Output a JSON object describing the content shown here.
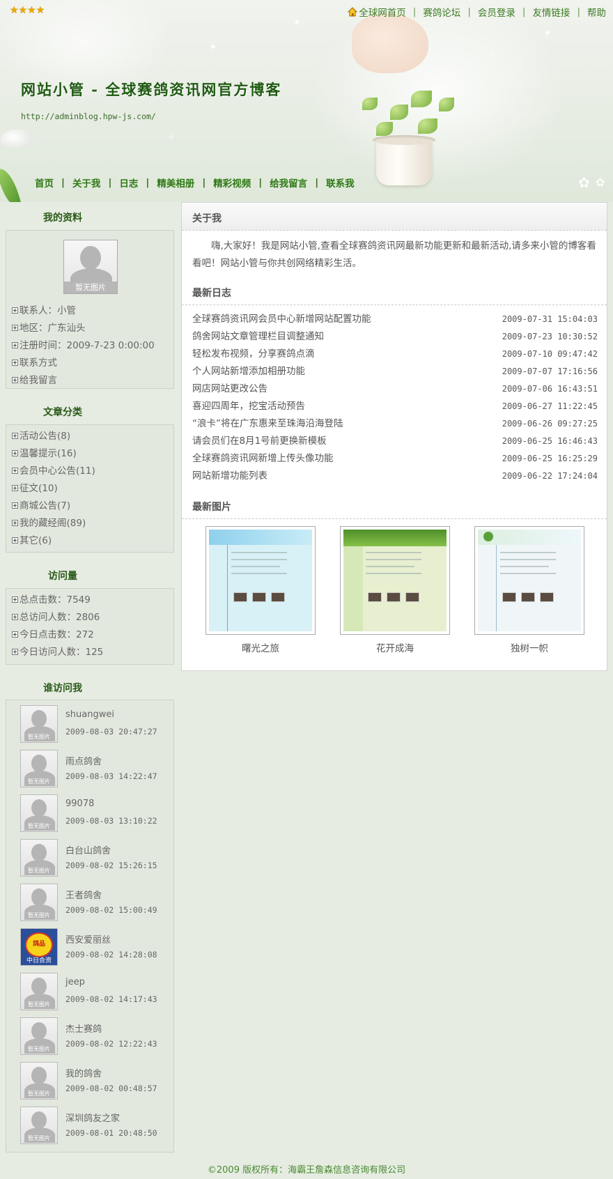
{
  "header": {
    "rating_stars": "★★★★",
    "site_title": "网站小管 - 全球赛鸽资讯网官方博客",
    "site_url": "http://adminblog.hpw-js.com/",
    "top_links": [
      "全球网首页",
      "赛鸽论坛",
      "会员登录",
      "友情链接",
      "帮助"
    ],
    "nav": [
      "首页",
      "关于我",
      "日志",
      "精美相册",
      "精彩视频",
      "给我留言",
      "联系我"
    ]
  },
  "profile": {
    "title": "我的资料",
    "avatar_caption": "暂无图片",
    "items": [
      "联系人：小管",
      "地区：广东汕头",
      "注册时间：2009-7-23 0:00:00",
      "联系方式",
      "给我留言"
    ]
  },
  "categories": {
    "title": "文章分类",
    "items": [
      "活动公告(8)",
      "温馨提示(16)",
      "会员中心公告(11)",
      "征文(10)",
      "商城公告(7)",
      "我的藏经阁(89)",
      "其它(6)"
    ]
  },
  "stats": {
    "title": "访问量",
    "items": [
      "总点击数：7549",
      "总访问人数：2806",
      "今日点击数：272",
      "今日访问人数：125"
    ]
  },
  "visitors": {
    "title": "谁访问我",
    "avatar_caption": "暂无图片",
    "special_avatar": {
      "badge": "鸽品",
      "caption": "中日合资"
    },
    "items": [
      {
        "name": "shuangwei",
        "time": "2009-08-03 20:47:27"
      },
      {
        "name": "雨点鸽舍",
        "time": "2009-08-03 14:22:47"
      },
      {
        "name": "99078",
        "time": "2009-08-03 13:10:22"
      },
      {
        "name": "白台山鸽舍",
        "time": "2009-08-02 15:26:15"
      },
      {
        "name": "王者鸽舍",
        "time": "2009-08-02 15:00:49"
      },
      {
        "name": "西安爱丽丝",
        "time": "2009-08-02 14:28:08"
      },
      {
        "name": "jeep",
        "time": "2009-08-02 14:17:43"
      },
      {
        "name": "杰士赛鸽",
        "time": "2009-08-02 12:22:43"
      },
      {
        "name": "我的鸽舍",
        "time": "2009-08-02 00:48:57"
      },
      {
        "name": "深圳鸽友之家",
        "time": "2009-08-01 20:48:50"
      }
    ]
  },
  "about": {
    "title": "关于我",
    "text": "嗨,大家好！我是网站小管,查看全球赛鸽资讯网最新功能更新和最新活动,请多来小管的博客看看吧！网站小管与你共创网络精彩生活。"
  },
  "latest_posts": {
    "title": "最新日志",
    "items": [
      {
        "title": "全球赛鸽资讯网会员中心新增网站配置功能",
        "date": "2009-07-31 15:04:03"
      },
      {
        "title": "鸽舍网站文章管理栏目调整通知",
        "date": "2009-07-23 10:30:52"
      },
      {
        "title": "轻松发布视频，分享赛鸽点滴",
        "date": "2009-07-10 09:47:42"
      },
      {
        "title": "个人网站新增添加相册功能",
        "date": "2009-07-07 17:16:56"
      },
      {
        "title": "网店网站更改公告",
        "date": "2009-07-06 16:43:51"
      },
      {
        "title": "喜迎四周年，挖宝活动预告",
        "date": "2009-06-27 11:22:45"
      },
      {
        "title": "“浪卡”将在广东惠来至珠海沿海登陆",
        "date": "2009-06-26 09:27:25"
      },
      {
        "title": "请会员们在8月1号前更换新模板",
        "date": "2009-06-25 16:46:43"
      },
      {
        "title": "全球赛鸽资讯网新增上传头像功能",
        "date": "2009-06-25 16:25:29"
      },
      {
        "title": "网站新增功能列表",
        "date": "2009-06-22 17:24:04"
      }
    ]
  },
  "latest_photos": {
    "title": "最新图片",
    "items": [
      {
        "caption": "曙光之旅",
        "theme": "#d8eef6"
      },
      {
        "caption": "花开成海",
        "theme": "#d9e8c0"
      },
      {
        "caption": "独树一帜",
        "theme": "#e8f2f6"
      }
    ]
  },
  "footer": {
    "text": "©2009 版权所有：海霸王詹森信息咨询有限公司"
  },
  "colors": {
    "accent_green": "#2e7a14",
    "link_green": "#3b7a23",
    "page_bg": "#e6ece2"
  }
}
